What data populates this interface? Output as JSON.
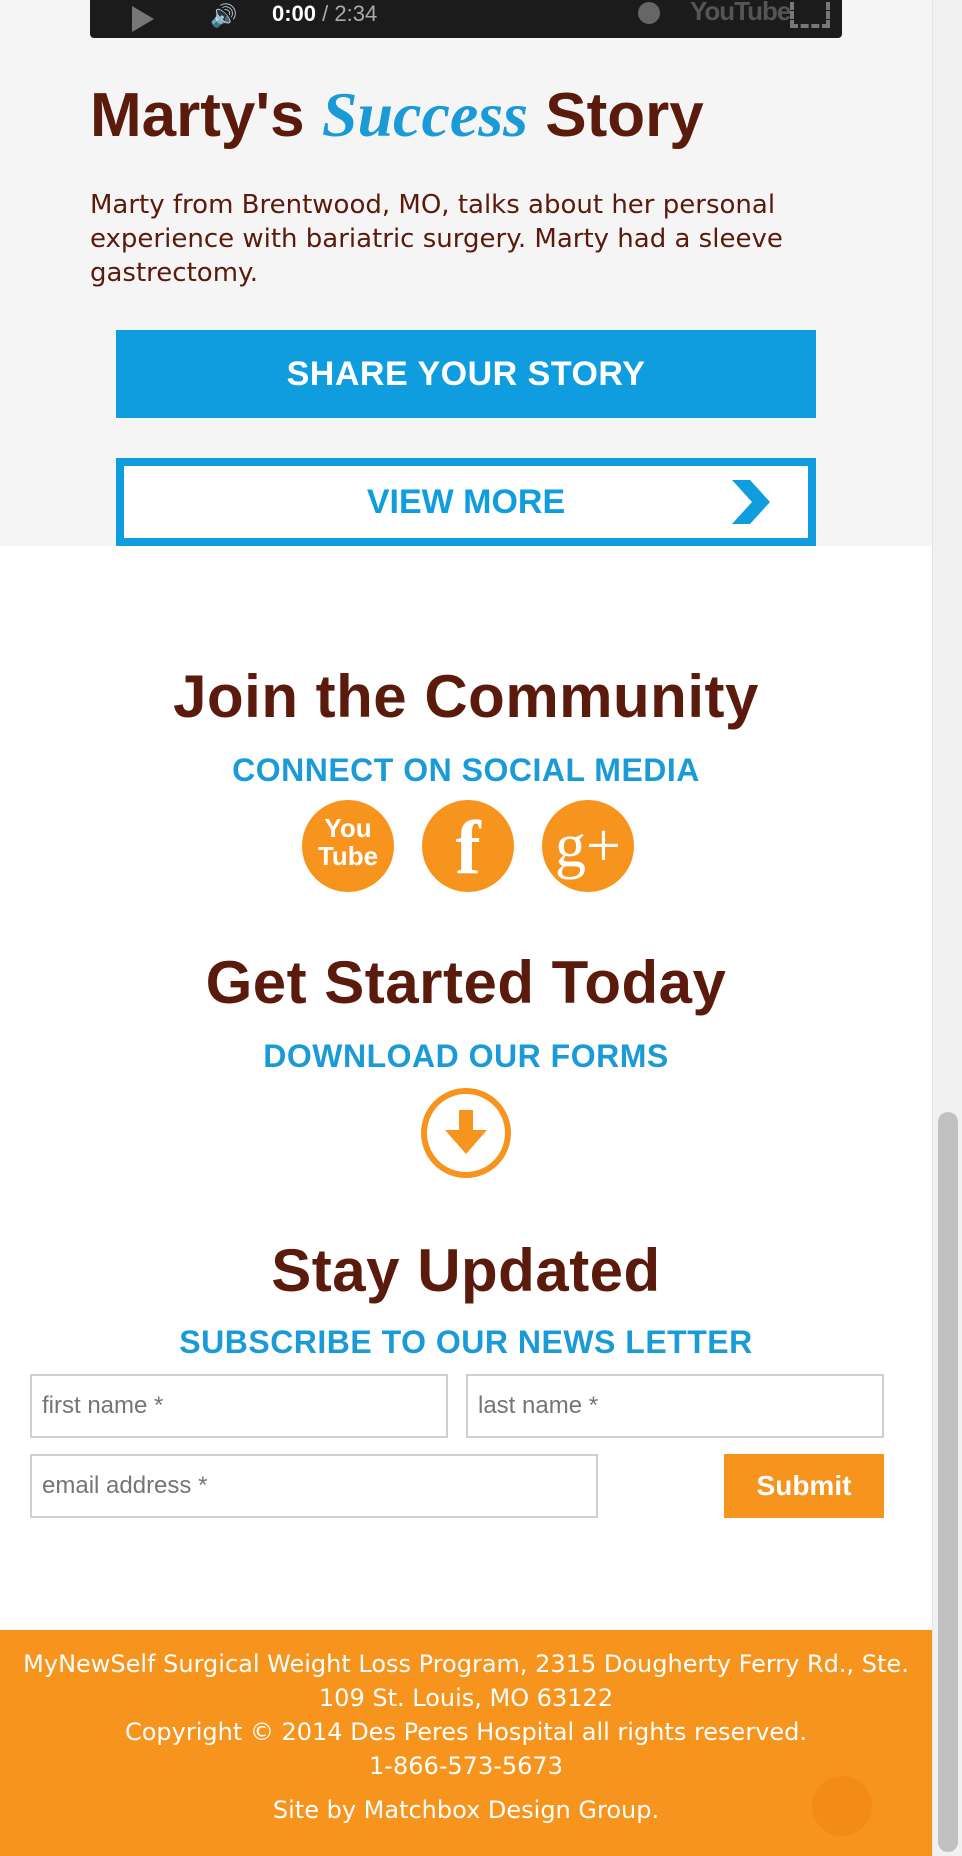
{
  "video": {
    "current_time": "0:00",
    "duration": "/ 2:34",
    "brand": "YouTube"
  },
  "story": {
    "title_start": "Marty's ",
    "title_accent": "Success",
    "title_end": " Story",
    "description": "Marty from Brentwood, MO, talks about her personal experience with bariatric surgery. Marty had a sleeve gastrectomy.",
    "share_button": "SHARE YOUR STORY",
    "view_more_button": "VIEW MORE"
  },
  "community": {
    "title": "Join the Community",
    "subtitle": "CONNECT ON SOCIAL MEDIA",
    "social": [
      {
        "name": "youtube",
        "label_top": "You",
        "label_bottom": "Tube"
      },
      {
        "name": "facebook",
        "label": "f"
      },
      {
        "name": "google-plus",
        "label": "g+"
      }
    ]
  },
  "get_started": {
    "title": "Get Started Today",
    "subtitle": "DOWNLOAD OUR FORMS"
  },
  "stay_updated": {
    "title": "Stay Updated",
    "subtitle": "SUBSCRIBE TO OUR NEWS LETTER",
    "first_name_placeholder": "first name *",
    "last_name_placeholder": "last name *",
    "email_placeholder": "email address *",
    "submit_label": "Submit"
  },
  "footer": {
    "address_line1": "MyNewSelf Surgical Weight Loss Program, 2315 Dougherty Ferry Rd., Ste.",
    "address_line2": "109 St. Louis, MO 63122",
    "copyright": "Copyright © 2014 Des Peres Hospital all rights reserved.",
    "phone": "1-866-573-5673",
    "credit": "Site by Matchbox Design Group."
  },
  "colors": {
    "brown": "#5a1a0c",
    "blue": "#1a9bd7",
    "orange": "#f7941d"
  }
}
